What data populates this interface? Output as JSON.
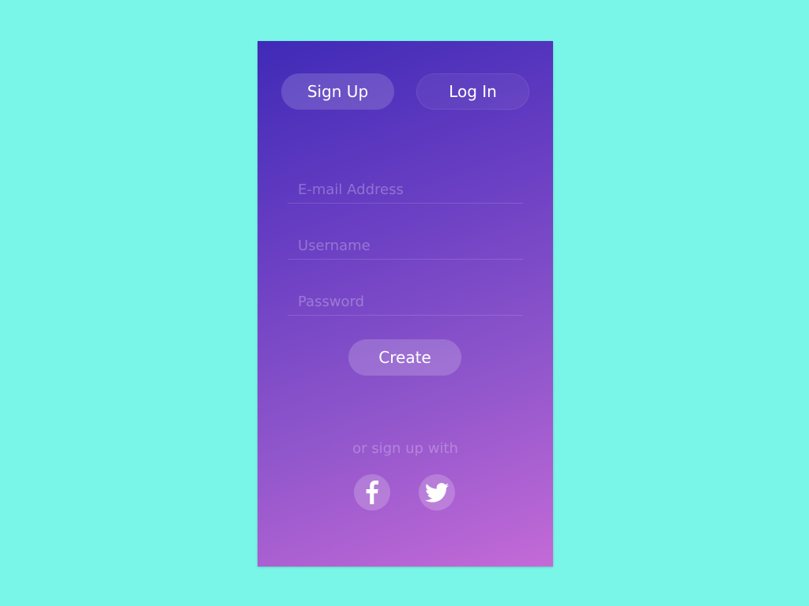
{
  "tabs": {
    "signup_label": "Sign Up",
    "login_label": "Log In"
  },
  "form": {
    "email_placeholder": "E-mail Address",
    "username_placeholder": "Username",
    "password_placeholder": "Password",
    "email_value": "",
    "username_value": "",
    "password_value": "",
    "create_label": "Create"
  },
  "social": {
    "caption": "or sign up with",
    "providers": [
      {
        "name": "facebook",
        "icon": "facebook-icon"
      },
      {
        "name": "twitter",
        "icon": "twitter-icon"
      }
    ]
  },
  "colors": {
    "background": "#7af6e8",
    "gradient_start": "#3f2ab7",
    "gradient_end": "#c46ad7",
    "text": "#ffffff"
  }
}
